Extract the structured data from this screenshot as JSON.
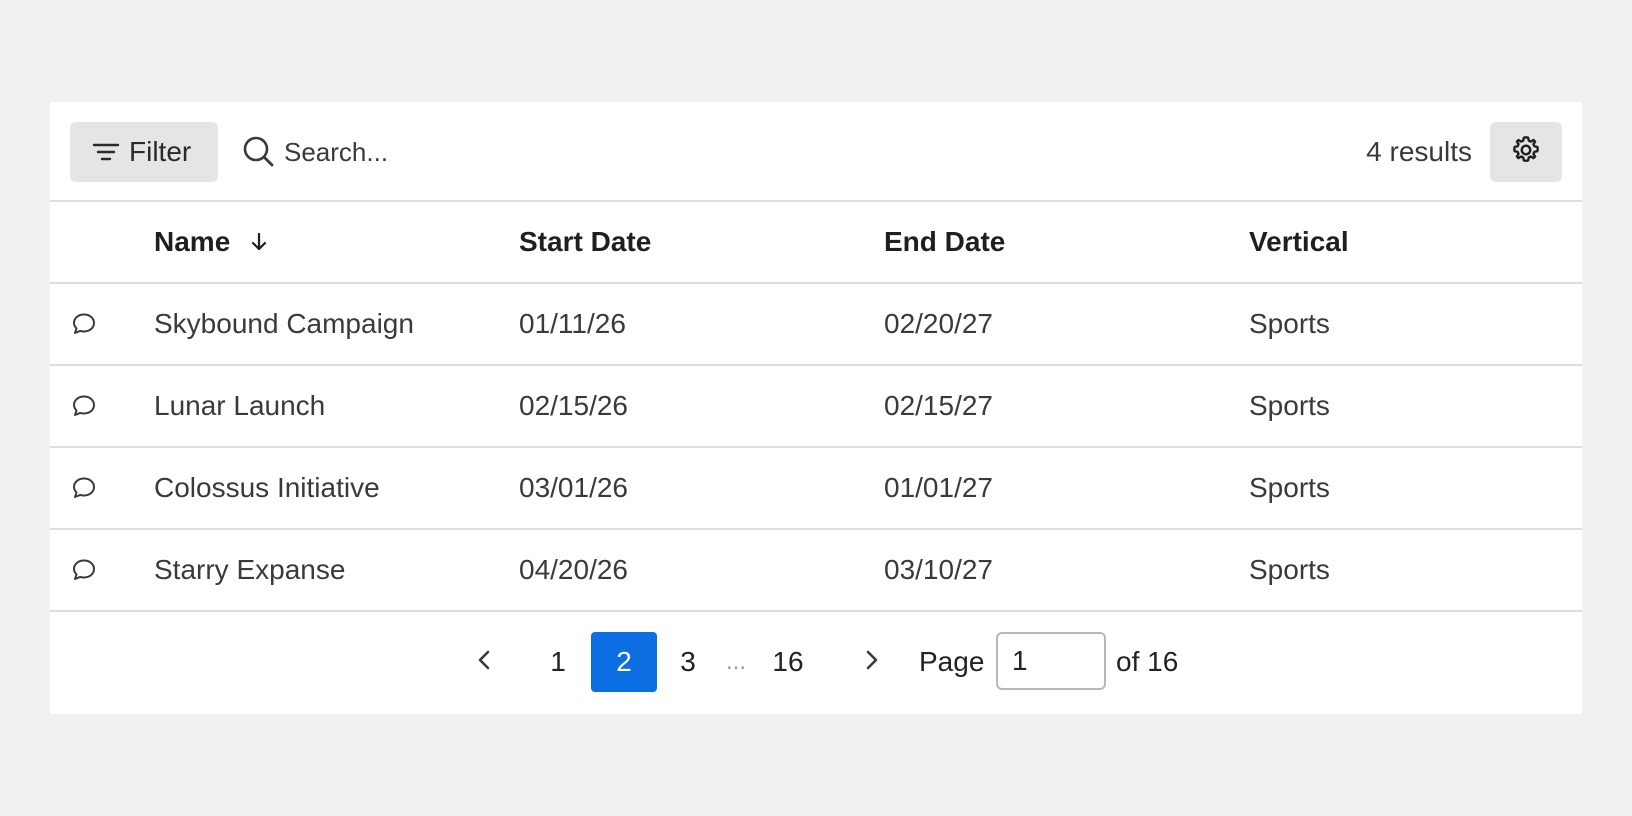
{
  "toolbar": {
    "filter_label": "Filter",
    "filter_icon": "filter-lines-icon",
    "search_icon": "search-icon",
    "search_placeholder": "Search...",
    "results_text": "4 results",
    "settings_icon": "gear-icon"
  },
  "table": {
    "columns": [
      "Name",
      "Start Date",
      "End Date",
      "Vertical"
    ],
    "sort_icon": "arrow-down-icon",
    "sort_column": "Name",
    "rows": [
      {
        "icon": "comment-icon",
        "name": "Skybound Campaign",
        "start": "01/11/26",
        "end": "02/20/27",
        "vertical": "Sports"
      },
      {
        "icon": "comment-icon",
        "name": "Lunar Launch",
        "start": "02/15/26",
        "end": "02/15/27",
        "vertical": "Sports"
      },
      {
        "icon": "comment-icon",
        "name": "Colossus Initiative",
        "start": "03/01/26",
        "end": "01/01/27",
        "vertical": "Sports"
      },
      {
        "icon": "comment-icon",
        "name": "Starry Expanse",
        "start": "04/20/26",
        "end": "03/10/27",
        "vertical": "Sports"
      }
    ]
  },
  "pagination": {
    "prev_icon": "chevron-left-icon",
    "next_icon": "chevron-right-icon",
    "pages": [
      "1",
      "2",
      "3",
      "16"
    ],
    "current_page": "2",
    "ellipsis": "...",
    "page_label": "Page",
    "page_input_value": "1",
    "of_label": "of 16"
  },
  "colors": {
    "accent": "#0b6fe3",
    "button_bg": "#e5e5e5",
    "background": "#f1f1f1",
    "divider": "#dcdcdc"
  }
}
